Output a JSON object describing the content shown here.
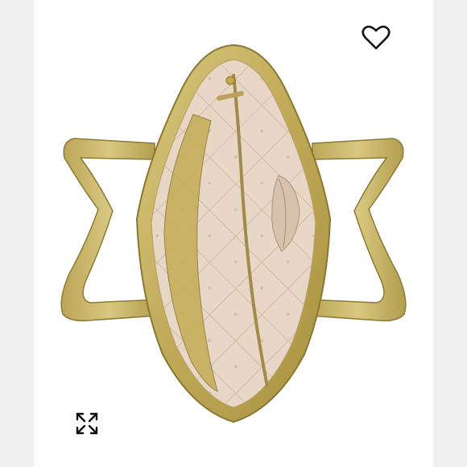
{
  "product": {
    "image_subject": "gold-metallic-tote-interior",
    "colors": {
      "leather": "#c9b565",
      "leather_dark": "#9c8a3c",
      "lining": "#e6d4c3",
      "lining_pattern": "#cdb59e",
      "page_bg": "#ffffff"
    }
  },
  "controls": {
    "favorite_icon": "heart-outline-icon",
    "expand_icon": "expand-arrows-icon"
  }
}
